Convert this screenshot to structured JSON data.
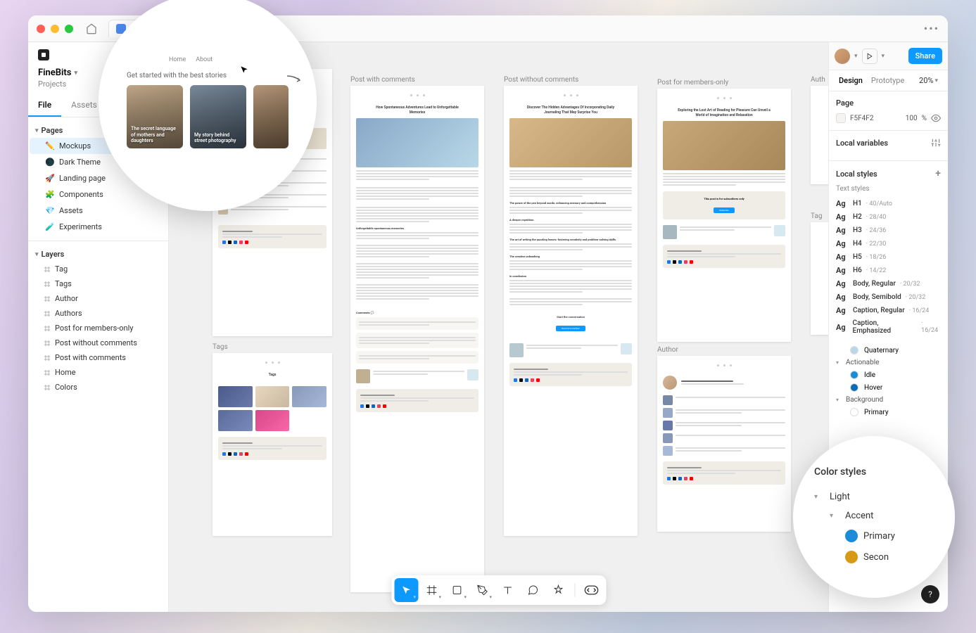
{
  "titlebar": {
    "tab_name": "FineBits",
    "menu": "•••"
  },
  "left": {
    "project_name": "FineBits",
    "project_sub": "Projects",
    "tabs": {
      "file": "File",
      "assets": "Assets"
    },
    "pages_label": "Pages",
    "pages": [
      {
        "icon": "✏️",
        "label": "Mockups",
        "active": true
      },
      {
        "icon": "🌑",
        "label": "Dark Theme"
      },
      {
        "icon": "🚀",
        "label": "Landing page"
      },
      {
        "icon": "🧩",
        "label": "Components"
      },
      {
        "icon": "💎",
        "label": "Assets"
      },
      {
        "icon": "🧪",
        "label": "Experiments"
      }
    ],
    "layers_label": "Layers",
    "layers": [
      "Tag",
      "Tags",
      "Author",
      "Authors",
      "Post for members-only",
      "Post without comments",
      "Post with comments",
      "Home",
      "Colors"
    ]
  },
  "canvas": {
    "frames": {
      "home": "Home",
      "tags": "Tags",
      "post_comments": "Post with comments",
      "post_no_comments": "Post without comments",
      "post_members": "Post for members-only",
      "author": "Author",
      "auth_label": "Auth",
      "tag_label": "Tag"
    },
    "titles": {
      "post_comments": "How Spontaneous Adventures Lead to Unforgettable Memories",
      "post_no_comments": "Discover The Hidden Advantages Of Incorporating Daily Journaling That May Surprise You",
      "post_members": "Exploring the Lost Art of Reading for Pleasure Can Unveil a World of Imagination and Relaxation",
      "tags_page": "Tags",
      "comments": "Comments 💬"
    }
  },
  "zoom1": {
    "label": "Get started with the best stories",
    "card1": "The secret language of mothers and daughters",
    "card2": "My story behind street photography"
  },
  "zoom2": {
    "title": "Color styles",
    "light": "Light",
    "accent": "Accent",
    "primary": "Primary",
    "secondary": "Secon"
  },
  "right": {
    "share": "Share",
    "tab_design": "Design",
    "tab_prototype": "Prototype",
    "zoom": "20%",
    "page_label": "Page",
    "bg_hex": "F5F4F2",
    "bg_pct": "100",
    "bg_unit": "%",
    "local_vars": "Local variables",
    "local_styles": "Local styles",
    "text_styles": "Text styles",
    "styles": [
      {
        "name": "H1",
        "meta": "40/Auto"
      },
      {
        "name": "H2",
        "meta": "28/40"
      },
      {
        "name": "H3",
        "meta": "24/36"
      },
      {
        "name": "H4",
        "meta": "22/30"
      },
      {
        "name": "H5",
        "meta": "18/26"
      },
      {
        "name": "H6",
        "meta": "14/22"
      },
      {
        "name": "Body, Regular",
        "meta": "20/32"
      },
      {
        "name": "Body, Semibold",
        "meta": "20/32"
      },
      {
        "name": "Caption, Regular",
        "meta": "16/24"
      },
      {
        "name": "Caption, Emphasized",
        "meta": "16/24"
      }
    ],
    "colors": {
      "quaternary": "Quaternary",
      "actionable": "Actionable",
      "idle": "Idle",
      "hover": "Hover",
      "background": "Background",
      "primary": "Primary"
    }
  },
  "help": "?"
}
